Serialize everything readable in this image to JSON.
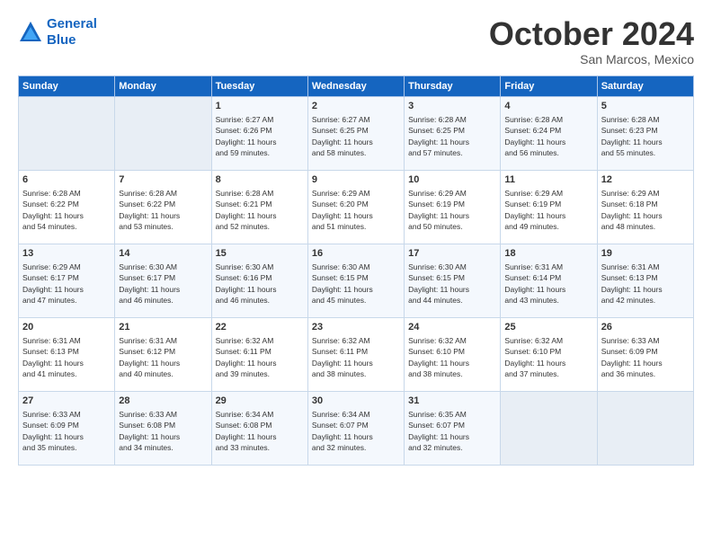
{
  "header": {
    "logo_line1": "General",
    "logo_line2": "Blue",
    "month": "October 2024",
    "location": "San Marcos, Mexico"
  },
  "weekdays": [
    "Sunday",
    "Monday",
    "Tuesday",
    "Wednesday",
    "Thursday",
    "Friday",
    "Saturday"
  ],
  "weeks": [
    [
      {
        "day": "",
        "info": ""
      },
      {
        "day": "",
        "info": ""
      },
      {
        "day": "1",
        "info": "Sunrise: 6:27 AM\nSunset: 6:26 PM\nDaylight: 11 hours\nand 59 minutes."
      },
      {
        "day": "2",
        "info": "Sunrise: 6:27 AM\nSunset: 6:25 PM\nDaylight: 11 hours\nand 58 minutes."
      },
      {
        "day": "3",
        "info": "Sunrise: 6:28 AM\nSunset: 6:25 PM\nDaylight: 11 hours\nand 57 minutes."
      },
      {
        "day": "4",
        "info": "Sunrise: 6:28 AM\nSunset: 6:24 PM\nDaylight: 11 hours\nand 56 minutes."
      },
      {
        "day": "5",
        "info": "Sunrise: 6:28 AM\nSunset: 6:23 PM\nDaylight: 11 hours\nand 55 minutes."
      }
    ],
    [
      {
        "day": "6",
        "info": "Sunrise: 6:28 AM\nSunset: 6:22 PM\nDaylight: 11 hours\nand 54 minutes."
      },
      {
        "day": "7",
        "info": "Sunrise: 6:28 AM\nSunset: 6:22 PM\nDaylight: 11 hours\nand 53 minutes."
      },
      {
        "day": "8",
        "info": "Sunrise: 6:28 AM\nSunset: 6:21 PM\nDaylight: 11 hours\nand 52 minutes."
      },
      {
        "day": "9",
        "info": "Sunrise: 6:29 AM\nSunset: 6:20 PM\nDaylight: 11 hours\nand 51 minutes."
      },
      {
        "day": "10",
        "info": "Sunrise: 6:29 AM\nSunset: 6:19 PM\nDaylight: 11 hours\nand 50 minutes."
      },
      {
        "day": "11",
        "info": "Sunrise: 6:29 AM\nSunset: 6:19 PM\nDaylight: 11 hours\nand 49 minutes."
      },
      {
        "day": "12",
        "info": "Sunrise: 6:29 AM\nSunset: 6:18 PM\nDaylight: 11 hours\nand 48 minutes."
      }
    ],
    [
      {
        "day": "13",
        "info": "Sunrise: 6:29 AM\nSunset: 6:17 PM\nDaylight: 11 hours\nand 47 minutes."
      },
      {
        "day": "14",
        "info": "Sunrise: 6:30 AM\nSunset: 6:17 PM\nDaylight: 11 hours\nand 46 minutes."
      },
      {
        "day": "15",
        "info": "Sunrise: 6:30 AM\nSunset: 6:16 PM\nDaylight: 11 hours\nand 46 minutes."
      },
      {
        "day": "16",
        "info": "Sunrise: 6:30 AM\nSunset: 6:15 PM\nDaylight: 11 hours\nand 45 minutes."
      },
      {
        "day": "17",
        "info": "Sunrise: 6:30 AM\nSunset: 6:15 PM\nDaylight: 11 hours\nand 44 minutes."
      },
      {
        "day": "18",
        "info": "Sunrise: 6:31 AM\nSunset: 6:14 PM\nDaylight: 11 hours\nand 43 minutes."
      },
      {
        "day": "19",
        "info": "Sunrise: 6:31 AM\nSunset: 6:13 PM\nDaylight: 11 hours\nand 42 minutes."
      }
    ],
    [
      {
        "day": "20",
        "info": "Sunrise: 6:31 AM\nSunset: 6:13 PM\nDaylight: 11 hours\nand 41 minutes."
      },
      {
        "day": "21",
        "info": "Sunrise: 6:31 AM\nSunset: 6:12 PM\nDaylight: 11 hours\nand 40 minutes."
      },
      {
        "day": "22",
        "info": "Sunrise: 6:32 AM\nSunset: 6:11 PM\nDaylight: 11 hours\nand 39 minutes."
      },
      {
        "day": "23",
        "info": "Sunrise: 6:32 AM\nSunset: 6:11 PM\nDaylight: 11 hours\nand 38 minutes."
      },
      {
        "day": "24",
        "info": "Sunrise: 6:32 AM\nSunset: 6:10 PM\nDaylight: 11 hours\nand 38 minutes."
      },
      {
        "day": "25",
        "info": "Sunrise: 6:32 AM\nSunset: 6:10 PM\nDaylight: 11 hours\nand 37 minutes."
      },
      {
        "day": "26",
        "info": "Sunrise: 6:33 AM\nSunset: 6:09 PM\nDaylight: 11 hours\nand 36 minutes."
      }
    ],
    [
      {
        "day": "27",
        "info": "Sunrise: 6:33 AM\nSunset: 6:09 PM\nDaylight: 11 hours\nand 35 minutes."
      },
      {
        "day": "28",
        "info": "Sunrise: 6:33 AM\nSunset: 6:08 PM\nDaylight: 11 hours\nand 34 minutes."
      },
      {
        "day": "29",
        "info": "Sunrise: 6:34 AM\nSunset: 6:08 PM\nDaylight: 11 hours\nand 33 minutes."
      },
      {
        "day": "30",
        "info": "Sunrise: 6:34 AM\nSunset: 6:07 PM\nDaylight: 11 hours\nand 32 minutes."
      },
      {
        "day": "31",
        "info": "Sunrise: 6:35 AM\nSunset: 6:07 PM\nDaylight: 11 hours\nand 32 minutes."
      },
      {
        "day": "",
        "info": ""
      },
      {
        "day": "",
        "info": ""
      }
    ]
  ]
}
